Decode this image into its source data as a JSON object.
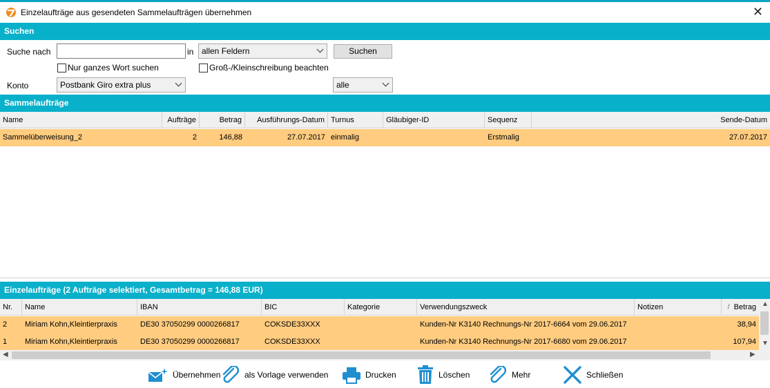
{
  "window": {
    "title": "Einzelaufträge aus gesendeten Sammelaufträgen übernehmen",
    "close_glyph": "✕"
  },
  "search": {
    "section_title": "Suchen",
    "label": "Suche nach",
    "query_value": "",
    "in_label": "in",
    "field_select": "allen Feldern",
    "search_button": "Suchen",
    "whole_word_label": "Nur ganzes Wort suchen",
    "whole_word_checked": false,
    "case_label": "Groß-/Kleinschreibung beachten",
    "case_checked": false,
    "account_label": "Konto",
    "account_select": "Postbank Giro extra plus",
    "filter_select": "alle"
  },
  "batch": {
    "section_title": "Sammelaufträge",
    "columns": [
      "Name",
      "Aufträge",
      "Betrag",
      "Ausführungs-Datum",
      "Turnus",
      "Gläubiger-ID",
      "Sequenz",
      "Sende-Datum"
    ],
    "rows": [
      {
        "name": "Sammelüberweisung_2",
        "count": "2",
        "amount": "146,88",
        "exec_date": "27.07.2017",
        "turnus": "einmalig",
        "creditor_id": "",
        "sequence": "Erstmalig",
        "send_date": "27.07.2017"
      }
    ]
  },
  "single": {
    "section_title": "Einzelaufträge (2 Aufträge selektiert, Gesamtbetrag = 146,88 EUR)",
    "columns": [
      "Nr.",
      "Name",
      "IBAN",
      "BIC",
      "Kategorie",
      "Verwendungszweck",
      "Notizen",
      "Betrag"
    ],
    "sort_indicator": "/",
    "rows": [
      {
        "nr": "2",
        "name": "Miriam Kohn,Kleintierpraxis",
        "iban": "DE30 37050299 0000266817",
        "bic": "COKSDE33XXX",
        "category": "",
        "purpose": "Kunden-Nr K3140 Rechnungs-Nr 2017-6664 vom 29.06.2017",
        "notes": "",
        "amount": "38,94"
      },
      {
        "nr": "1",
        "name": "Miriam Kohn,Kleintierpraxis",
        "iban": "DE30 37050299 0000266817",
        "bic": "COKSDE33XXX",
        "category": "",
        "purpose": "Kunden-Nr K3140 Rechnungs-Nr 2017-6680 vom 29.06.2017",
        "notes": "",
        "amount": "107,94"
      }
    ]
  },
  "toolbar": {
    "accept": "Übernehmen",
    "template": "als Vorlage verwenden",
    "print": "Drucken",
    "delete": "Löschen",
    "more": "Mehr",
    "close": "Schließen"
  },
  "colors": {
    "accent": "#09b0ca",
    "selected_row": "#ffcc80",
    "icon_blue": "#1f8fd0"
  }
}
